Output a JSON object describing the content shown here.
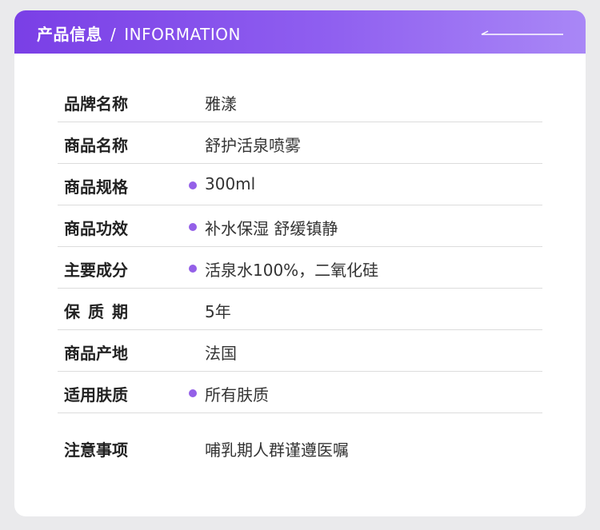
{
  "header": {
    "title_cn": "产品信息",
    "separator": "/",
    "title_en": "INFORMATION"
  },
  "colors": {
    "header_gradient_start": "#7a3fe6",
    "header_gradient_end": "#a987f6",
    "bullet": "#9460e8"
  },
  "rows": [
    {
      "label": "品牌名称",
      "value": "雅漾",
      "bullet": false
    },
    {
      "label": "商品名称",
      "value": "舒护活泉喷雾",
      "bullet": false
    },
    {
      "label": "商品规格",
      "value": "300ml",
      "bullet": true
    },
    {
      "label": "商品功效",
      "value": "补水保湿 舒缓镇静",
      "bullet": true
    },
    {
      "label": "主要成分",
      "value": "活泉水100%，二氧化硅",
      "bullet": true
    },
    {
      "label": "保质期",
      "value": "5年",
      "bullet": false
    },
    {
      "label": "商品产地",
      "value": "法国",
      "bullet": false
    },
    {
      "label": "适用肤质",
      "value": "所有肤质",
      "bullet": true
    },
    {
      "label": "注意事项",
      "value": "哺乳期人群谨遵医嘱",
      "bullet": false
    }
  ]
}
